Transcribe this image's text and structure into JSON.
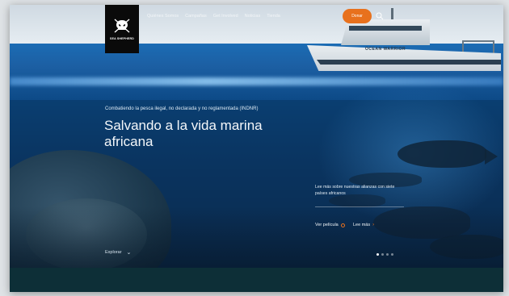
{
  "header": {
    "logo_text": "SEA SHEPHERD",
    "nav": [
      "Quiénes Somos",
      "Campañas",
      "Get Involved",
      "Noticias",
      "Tienda"
    ],
    "donate_label": "Donar",
    "search_icon": "search-icon"
  },
  "ship": {
    "name": "OCEAN WARRIOR"
  },
  "hero": {
    "eyebrow": "Combatiendo la pesca ilegal, no declarada y no reglamentada (INDNR)",
    "title": "Salvando a la vida marina africana",
    "side_text": "Lee más sobre nuestras alianzas con siete países africanos",
    "link_pelicula": "Ver película",
    "link_leer": "Lee más",
    "explore": "Explorar"
  },
  "pager": {
    "count": 4,
    "active_index": 0
  },
  "colors": {
    "accent": "#e8711d",
    "footer": "#0d2f37",
    "logo_bg": "#0a0a0a"
  }
}
